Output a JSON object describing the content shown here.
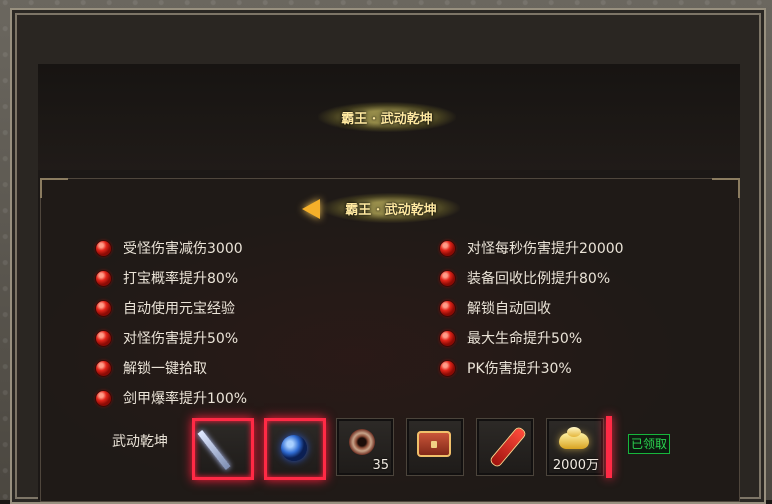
{
  "header": {
    "title": "霸王 · 武动乾坤"
  },
  "section": {
    "title": "霸王 · 武动乾坤",
    "back_icon": "arrow-left-icon",
    "accent": "#f5b02a"
  },
  "stats": {
    "left": [
      "受怪伤害减伤3000",
      "打宝概率提升80%",
      "自动使用元宝经验",
      "对怪伤害提升50%",
      "解锁一键拾取",
      "剑甲爆率提升100%"
    ],
    "right": [
      "对怪每秒伤害提升20000",
      "装备回收比例提升80%",
      "解锁自动回收",
      "最大生命提升50%",
      "PK伤害提升30%"
    ]
  },
  "rewards": {
    "label": "武动乾坤",
    "items": [
      {
        "icon": "sword-icon",
        "qty": ""
      },
      {
        "icon": "blue-orb-icon",
        "qty": ""
      },
      {
        "icon": "disc-icon",
        "qty": "35"
      },
      {
        "icon": "treasure-chest-icon",
        "qty": ""
      },
      {
        "icon": "scroll-icon",
        "qty": ""
      },
      {
        "icon": "gold-ingot-icon",
        "qty": "2000万"
      }
    ],
    "status": "已领取",
    "status_color": "#2bd24f",
    "glow_color": "#ff2a45"
  }
}
